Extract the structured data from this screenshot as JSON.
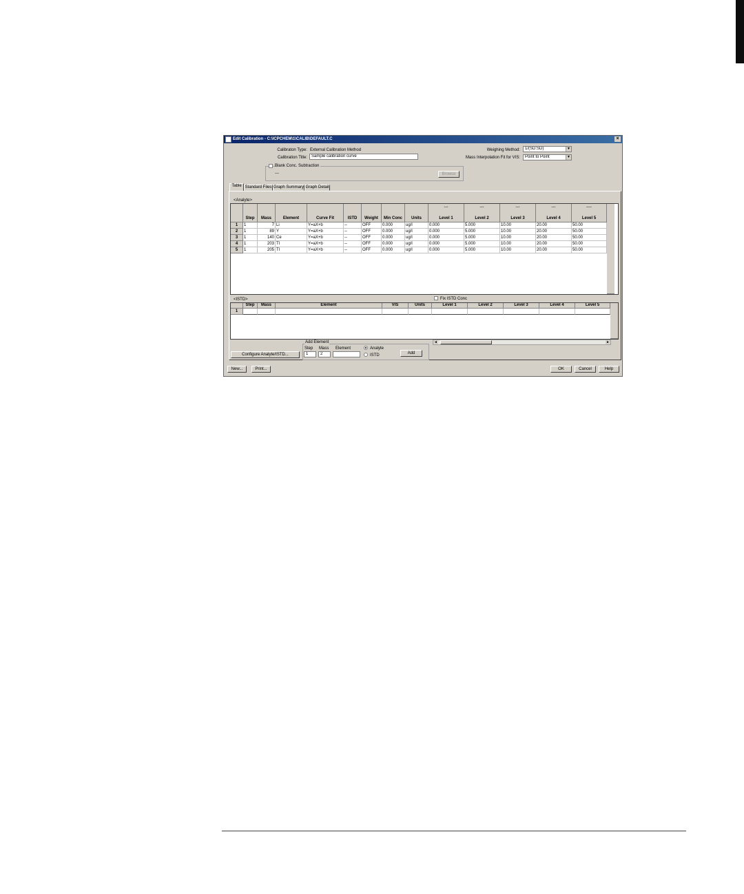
{
  "window": {
    "title": "Edit Calibration - C:\\ICPCHEM\\1\\CALIB\\DEFAULT.C",
    "close_glyph": "×"
  },
  "header": {
    "calibration_type_label": "Calibraton Type:",
    "calibration_type_value": "External Calibration Method",
    "calibration_title_label": "Calibration Title:",
    "calibration_title_value": "Sample calibration curve",
    "weighing_method_label": "Weighing Method:",
    "weighing_method_value": "1/(SD:SD)",
    "mass_interp_label": "Mass Interpolation Fit for VIS:",
    "mass_interp_value": "Point to Point",
    "blank_label": "Blank Conc. Subtraction",
    "blank_value": "---",
    "browse_label": "Browse"
  },
  "tabs": [
    "Table",
    "Standard Files",
    "Graph Summary",
    "Graph Detail"
  ],
  "analyte": {
    "section_label": "<Analyte>",
    "columns": [
      "Step",
      "Mass",
      "Element",
      "Curve Fit",
      "ISTD",
      "Weight",
      "Min Conc",
      "Units",
      "Level 1",
      "Level 2",
      "Level 3",
      "Level 4",
      "Level 5"
    ],
    "level_subheaders": [
      "---",
      "---",
      "---",
      "---",
      "----"
    ],
    "rows": [
      {
        "num": "1",
        "cells": [
          "1",
          "7",
          "Li",
          "Y=aX+b",
          "--",
          "OFF",
          "0.000",
          "ug/l",
          "0.000",
          "5.000",
          "10.00",
          "20.00",
          "50.00"
        ]
      },
      {
        "num": "2",
        "cells": [
          "1",
          "89",
          "Y",
          "Y=aX+b",
          "--",
          "OFF",
          "0.000",
          "ug/l",
          "0.000",
          "5.000",
          "10.00",
          "20.00",
          "50.00"
        ]
      },
      {
        "num": "3",
        "cells": [
          "1",
          "140",
          "Ce",
          "Y=aX+b",
          "--",
          "OFF",
          "0.000",
          "ug/l",
          "0.000",
          "5.000",
          "10.00",
          "20.00",
          "50.00"
        ]
      },
      {
        "num": "4",
        "cells": [
          "1",
          "203",
          "Tl",
          "Y=aX+b",
          "--",
          "OFF",
          "0.000",
          "ug/l",
          "0.000",
          "5.000",
          "10.00",
          "20.00",
          "50.00"
        ]
      },
      {
        "num": "5",
        "cells": [
          "1",
          "205",
          "Tl",
          "Y=aX+b",
          "--",
          "OFF",
          "0.000",
          "ug/l",
          "0.000",
          "5.000",
          "10.00",
          "20.00",
          "50.00"
        ]
      }
    ]
  },
  "istd": {
    "section_label": "<ISTD>",
    "fix_label": "Fix ISTD Conc",
    "columns": [
      "Step",
      "Mass",
      "Element",
      "VIS",
      "Units",
      "Level 1",
      "Level 2",
      "Level 3",
      "Level 4",
      "Level 5"
    ],
    "rows": [
      {
        "num": "1"
      }
    ]
  },
  "add_element": {
    "group_label": "Add Element",
    "step_label": "Step",
    "mass_label": "Mass",
    "element_label": "Element",
    "step_value": "1",
    "mass_value": "2",
    "element_value": "",
    "analyte_label": "Analyte",
    "istd_label": "ISTD",
    "add_label": "Add"
  },
  "configure_label": "Configure Analyte/ISTD...",
  "footer": {
    "new_label": "New...",
    "print_label": "Print...",
    "ok_label": "OK",
    "cancel_label": "Cancel",
    "help_label": "Help"
  }
}
